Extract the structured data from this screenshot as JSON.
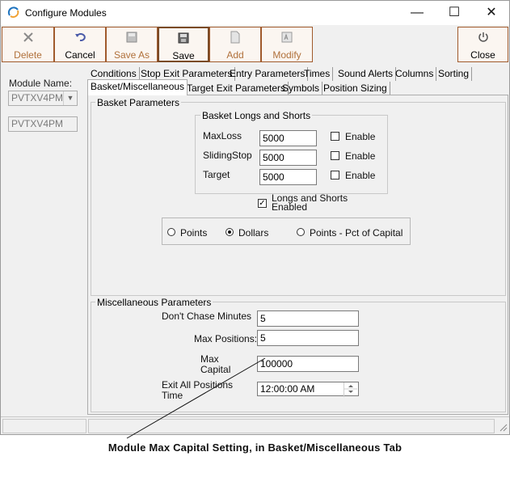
{
  "window": {
    "title": "Configure Modules",
    "minimize": "—",
    "maximize": "☐",
    "close": "✕"
  },
  "toolbar": {
    "delete": "Delete",
    "cancel": "Cancel",
    "save_as": "Save As",
    "save": "Save",
    "add": "Add",
    "modify": "Modify",
    "close": "Close"
  },
  "left": {
    "module_name_label": "Module Name:",
    "module_name_value": "PVTXV4PM",
    "module_name_text": "PVTXV4PM"
  },
  "tabs_row1": [
    "Conditions",
    "Stop Exit Parameters",
    "Entry Parameters",
    "Times",
    "Sound Alerts",
    "Columns",
    "Sorting"
  ],
  "tabs_row2": [
    "Basket/Miscellaneous",
    "Target Exit Parameters",
    "Symbols",
    "Position Sizing"
  ],
  "basket": {
    "title": "Basket Parameters",
    "longs_shorts_title": "Basket Longs and Shorts",
    "rows": [
      {
        "label": "MaxLoss",
        "value": "5000",
        "enable": "Enable"
      },
      {
        "label": "SlidingStop",
        "value": "5000",
        "enable": "Enable"
      },
      {
        "label": "Target",
        "value": "5000",
        "enable": "Enable"
      }
    ],
    "longs_shorts_enabled_line1": "Longs and Shorts",
    "longs_shorts_enabled_line2": "Enabled",
    "radio_points": "Points",
    "radio_dollars": "Dollars",
    "radio_pct": "Points - Pct of Capital",
    "selected_radio": "Dollars"
  },
  "misc": {
    "title": "Miscellaneous Parameters",
    "dont_chase_label": "Don't Chase Minutes",
    "dont_chase_value": "5",
    "max_positions_label": "Max Positions:",
    "max_positions_value": "5",
    "max_capital_label1": "Max",
    "max_capital_label2": "Capital",
    "max_capital_value": "100000",
    "exit_all_label1": "Exit All Positions",
    "exit_all_label2": "Time",
    "exit_all_value": "12:00:00 AM"
  },
  "caption": "Module Max Capital Setting, in Basket/Miscellaneous Tab"
}
